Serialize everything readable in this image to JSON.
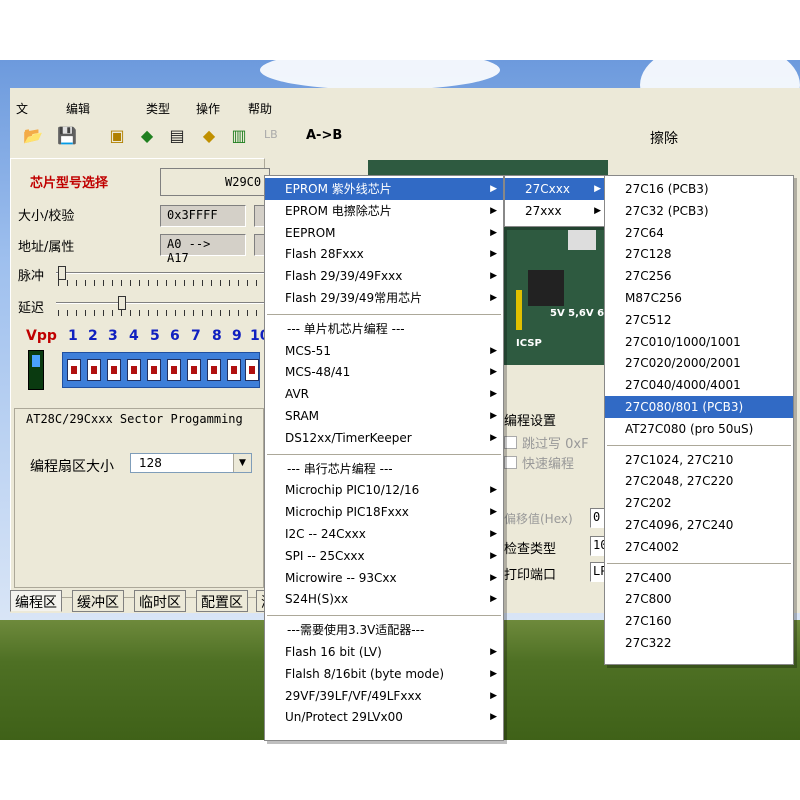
{
  "menubar": [
    "文",
    "编辑",
    "类型",
    "操作",
    "帮助"
  ],
  "toolbar": {
    "lb_label": "LB",
    "ab_label": "A->B",
    "erase_label": "擦除"
  },
  "left_panel": {
    "chip_select_label": "芯片型号选择",
    "chip_select_value": "W29C0",
    "size_label": "大小/校验",
    "size_value": "0x3FFFF",
    "addr_label": "地址/属性",
    "addr_value": "A0 --> A17",
    "pulse_label": "脉冲",
    "delay_label": "延迟",
    "vpp_label": "Vpp",
    "pins": [
      "1",
      "2",
      "3",
      "4",
      "5",
      "6",
      "7",
      "8",
      "9",
      "10"
    ],
    "sector_title": "AT28C/29Cxxx Sector Progamming",
    "sector_size_label": "编程扇区大小",
    "sector_size_value": "128"
  },
  "tabs": [
    "编程区",
    "缓冲区",
    "临时区",
    "配置区",
    "测"
  ],
  "board": {
    "label_icsp": "ICSP",
    "label_volt": "5V 5,6V 6."
  },
  "settings": {
    "title": "编程设置",
    "skip_label": "跳过写 0xF",
    "fast_label": "快速编程",
    "offset_label": "偏移值(Hex)",
    "offset_value": "0",
    "check_label": "检查类型",
    "check_value": "10",
    "port_label": "打印端口",
    "port_value": "LP"
  },
  "menu1": {
    "items": [
      {
        "label": "EPROM 紫外线芯片",
        "arrow": true,
        "selected": true
      },
      {
        "label": "EPROM 电擦除芯片",
        "arrow": true
      },
      {
        "label": "EEPROM",
        "arrow": true
      },
      {
        "label": "Flash 28Fxxx",
        "arrow": true
      },
      {
        "label": "Flash 29/39/49Fxxx",
        "arrow": true
      },
      {
        "label": "Flash 29/39/49常用芯片",
        "arrow": true
      },
      {
        "label": "--- 单片机芯片编程 ---",
        "header": true
      },
      {
        "label": "MCS-51",
        "arrow": true
      },
      {
        "label": "MCS-48/41",
        "arrow": true
      },
      {
        "label": "AVR",
        "arrow": true
      },
      {
        "label": "SRAM",
        "arrow": true
      },
      {
        "label": "DS12xx/TimerKeeper",
        "arrow": true
      },
      {
        "label": "--- 串行芯片编程 ---",
        "header": true
      },
      {
        "label": "Microchip PIC10/12/16",
        "arrow": true
      },
      {
        "label": "Microchip PIC18Fxxx",
        "arrow": true
      },
      {
        "label": "I2C -- 24Cxxx",
        "arrow": true
      },
      {
        "label": "SPI -- 25Cxxx",
        "arrow": true
      },
      {
        "label": "Microwire -- 93Cxx",
        "arrow": true
      },
      {
        "label": "S24H(S)xx",
        "arrow": true
      },
      {
        "label": "---需要使用3.3V适配器---",
        "header": true
      },
      {
        "label": "Flash 16 bit (LV)",
        "arrow": true
      },
      {
        "label": "Flalsh 8/16bit (byte mode)",
        "arrow": true
      },
      {
        "label": "29VF/39LF/VF/49LFxxx",
        "arrow": true
      },
      {
        "label": "Un/Protect 29LVx00",
        "arrow": true
      }
    ]
  },
  "menu2": {
    "items": [
      {
        "label": "27Cxxx",
        "arrow": true,
        "selected": true
      },
      {
        "label": "27xxx",
        "arrow": true
      }
    ]
  },
  "menu3": {
    "items": [
      {
        "label": "27C16   (PCB3)"
      },
      {
        "label": "27C32   (PCB3)"
      },
      {
        "label": "27C64"
      },
      {
        "label": "27C128"
      },
      {
        "label": "27C256"
      },
      {
        "label": "M87C256"
      },
      {
        "label": "27C512"
      },
      {
        "label": "27C010/1000/1001"
      },
      {
        "label": "27C020/2000/2001"
      },
      {
        "label": "27C040/4000/4001"
      },
      {
        "label": "27C080/801   (PCB3)",
        "selected": true
      },
      {
        "label": "AT27C080 (pro 50uS)"
      },
      {
        "label": "27C1024, 27C210"
      },
      {
        "label": "27C2048, 27C220"
      },
      {
        "label": "27C202"
      },
      {
        "label": "27C4096, 27C240"
      },
      {
        "label": "27C4002"
      },
      {
        "label": "27C400"
      },
      {
        "label": "27C800"
      },
      {
        "label": "27C160"
      },
      {
        "label": "27C322"
      }
    ]
  }
}
